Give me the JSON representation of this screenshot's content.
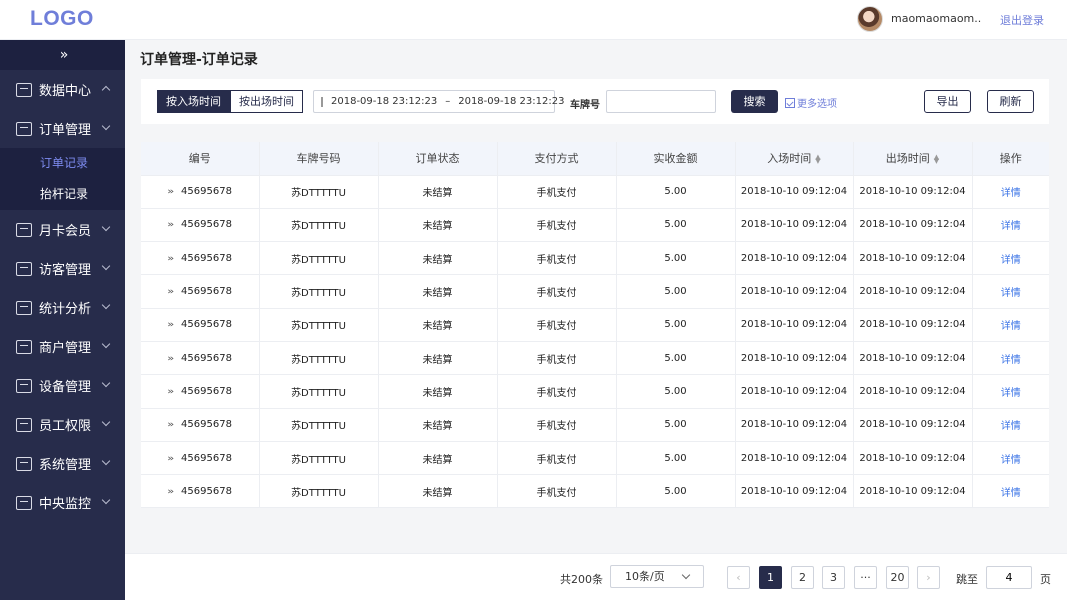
{
  "header": {
    "logo": "LOGO",
    "username": "maomaomaom...",
    "logout": "退出登录"
  },
  "sidebar": {
    "collapse": "»",
    "items": [
      {
        "label": "数据中心",
        "icon": "bar-chart-icon"
      },
      {
        "label": "订单管理",
        "icon": "order-icon",
        "sub": [
          "订单记录",
          "抬杆记录"
        ]
      },
      {
        "label": "月卡会员",
        "icon": "vip-card-icon"
      },
      {
        "label": "访客管理",
        "icon": "visitor-icon"
      },
      {
        "label": "统计分析",
        "icon": "line-chart-icon"
      },
      {
        "label": "商户管理",
        "icon": "merchant-icon"
      },
      {
        "label": "设备管理",
        "icon": "device-icon"
      },
      {
        "label": "员工权限",
        "icon": "staff-icon"
      },
      {
        "label": "系统管理",
        "icon": "settings-icon"
      },
      {
        "label": "中央监控",
        "icon": "monitor-icon"
      }
    ]
  },
  "page": {
    "title": "订单管理-订单记录"
  },
  "filters": {
    "tab_in": "按入场时间",
    "tab_out": "按出场时间",
    "date_start": "2018-09-18   23:12:23",
    "date_sep": "–",
    "date_end": "2018-09-18   23:12:23",
    "plate_label": "车牌号",
    "plate_value": "",
    "search": "搜索",
    "more": "更多选项",
    "export": "导出",
    "refresh": "刷新"
  },
  "table": {
    "columns": [
      "编号",
      "车牌号码",
      "订单状态",
      "支付方式",
      "实收金额",
      "入场时间",
      "出场时间",
      "操作"
    ],
    "rows": [
      {
        "id": "45695678",
        "plate": "苏DTTTTTU",
        "status": "未结算",
        "pay": "手机支付",
        "amount": "5.00",
        "in": "2018-10-10   09:12:04",
        "out": "2018-10-10   09:12:04",
        "action": "详情"
      },
      {
        "id": "45695678",
        "plate": "苏DTTTTTU",
        "status": "未结算",
        "pay": "手机支付",
        "amount": "5.00",
        "in": "2018-10-10   09:12:04",
        "out": "2018-10-10   09:12:04",
        "action": "详情"
      },
      {
        "id": "45695678",
        "plate": "苏DTTTTTU",
        "status": "未结算",
        "pay": "手机支付",
        "amount": "5.00",
        "in": "2018-10-10   09:12:04",
        "out": "2018-10-10   09:12:04",
        "action": "详情"
      },
      {
        "id": "45695678",
        "plate": "苏DTTTTTU",
        "status": "未结算",
        "pay": "手机支付",
        "amount": "5.00",
        "in": "2018-10-10   09:12:04",
        "out": "2018-10-10   09:12:04",
        "action": "详情"
      },
      {
        "id": "45695678",
        "plate": "苏DTTTTTU",
        "status": "未结算",
        "pay": "手机支付",
        "amount": "5.00",
        "in": "2018-10-10   09:12:04",
        "out": "2018-10-10   09:12:04",
        "action": "详情"
      },
      {
        "id": "45695678",
        "plate": "苏DTTTTTU",
        "status": "未结算",
        "pay": "手机支付",
        "amount": "5.00",
        "in": "2018-10-10   09:12:04",
        "out": "2018-10-10   09:12:04",
        "action": "详情"
      },
      {
        "id": "45695678",
        "plate": "苏DTTTTTU",
        "status": "未结算",
        "pay": "手机支付",
        "amount": "5.00",
        "in": "2018-10-10   09:12:04",
        "out": "2018-10-10   09:12:04",
        "action": "详情"
      },
      {
        "id": "45695678",
        "plate": "苏DTTTTTU",
        "status": "未结算",
        "pay": "手机支付",
        "amount": "5.00",
        "in": "2018-10-10   09:12:04",
        "out": "2018-10-10   09:12:04",
        "action": "详情"
      },
      {
        "id": "45695678",
        "plate": "苏DTTTTTU",
        "status": "未结算",
        "pay": "手机支付",
        "amount": "5.00",
        "in": "2018-10-10   09:12:04",
        "out": "2018-10-10   09:12:04",
        "action": "详情"
      },
      {
        "id": "45695678",
        "plate": "苏DTTTTTU",
        "status": "未结算",
        "pay": "手机支付",
        "amount": "5.00",
        "in": "2018-10-10   09:12:04",
        "out": "2018-10-10   09:12:04",
        "action": "详情"
      }
    ]
  },
  "pagination": {
    "total": "共200条",
    "page_size": "10条/页",
    "prev": "‹",
    "pages": [
      "1",
      "2",
      "3",
      "···",
      "20"
    ],
    "next": "›",
    "goto_label": "跳至",
    "goto_value": "4",
    "goto_suffix": "页"
  },
  "colors": {
    "primary": "#272c4b",
    "accent": "#6f7ed9",
    "link": "#3a73e6"
  }
}
